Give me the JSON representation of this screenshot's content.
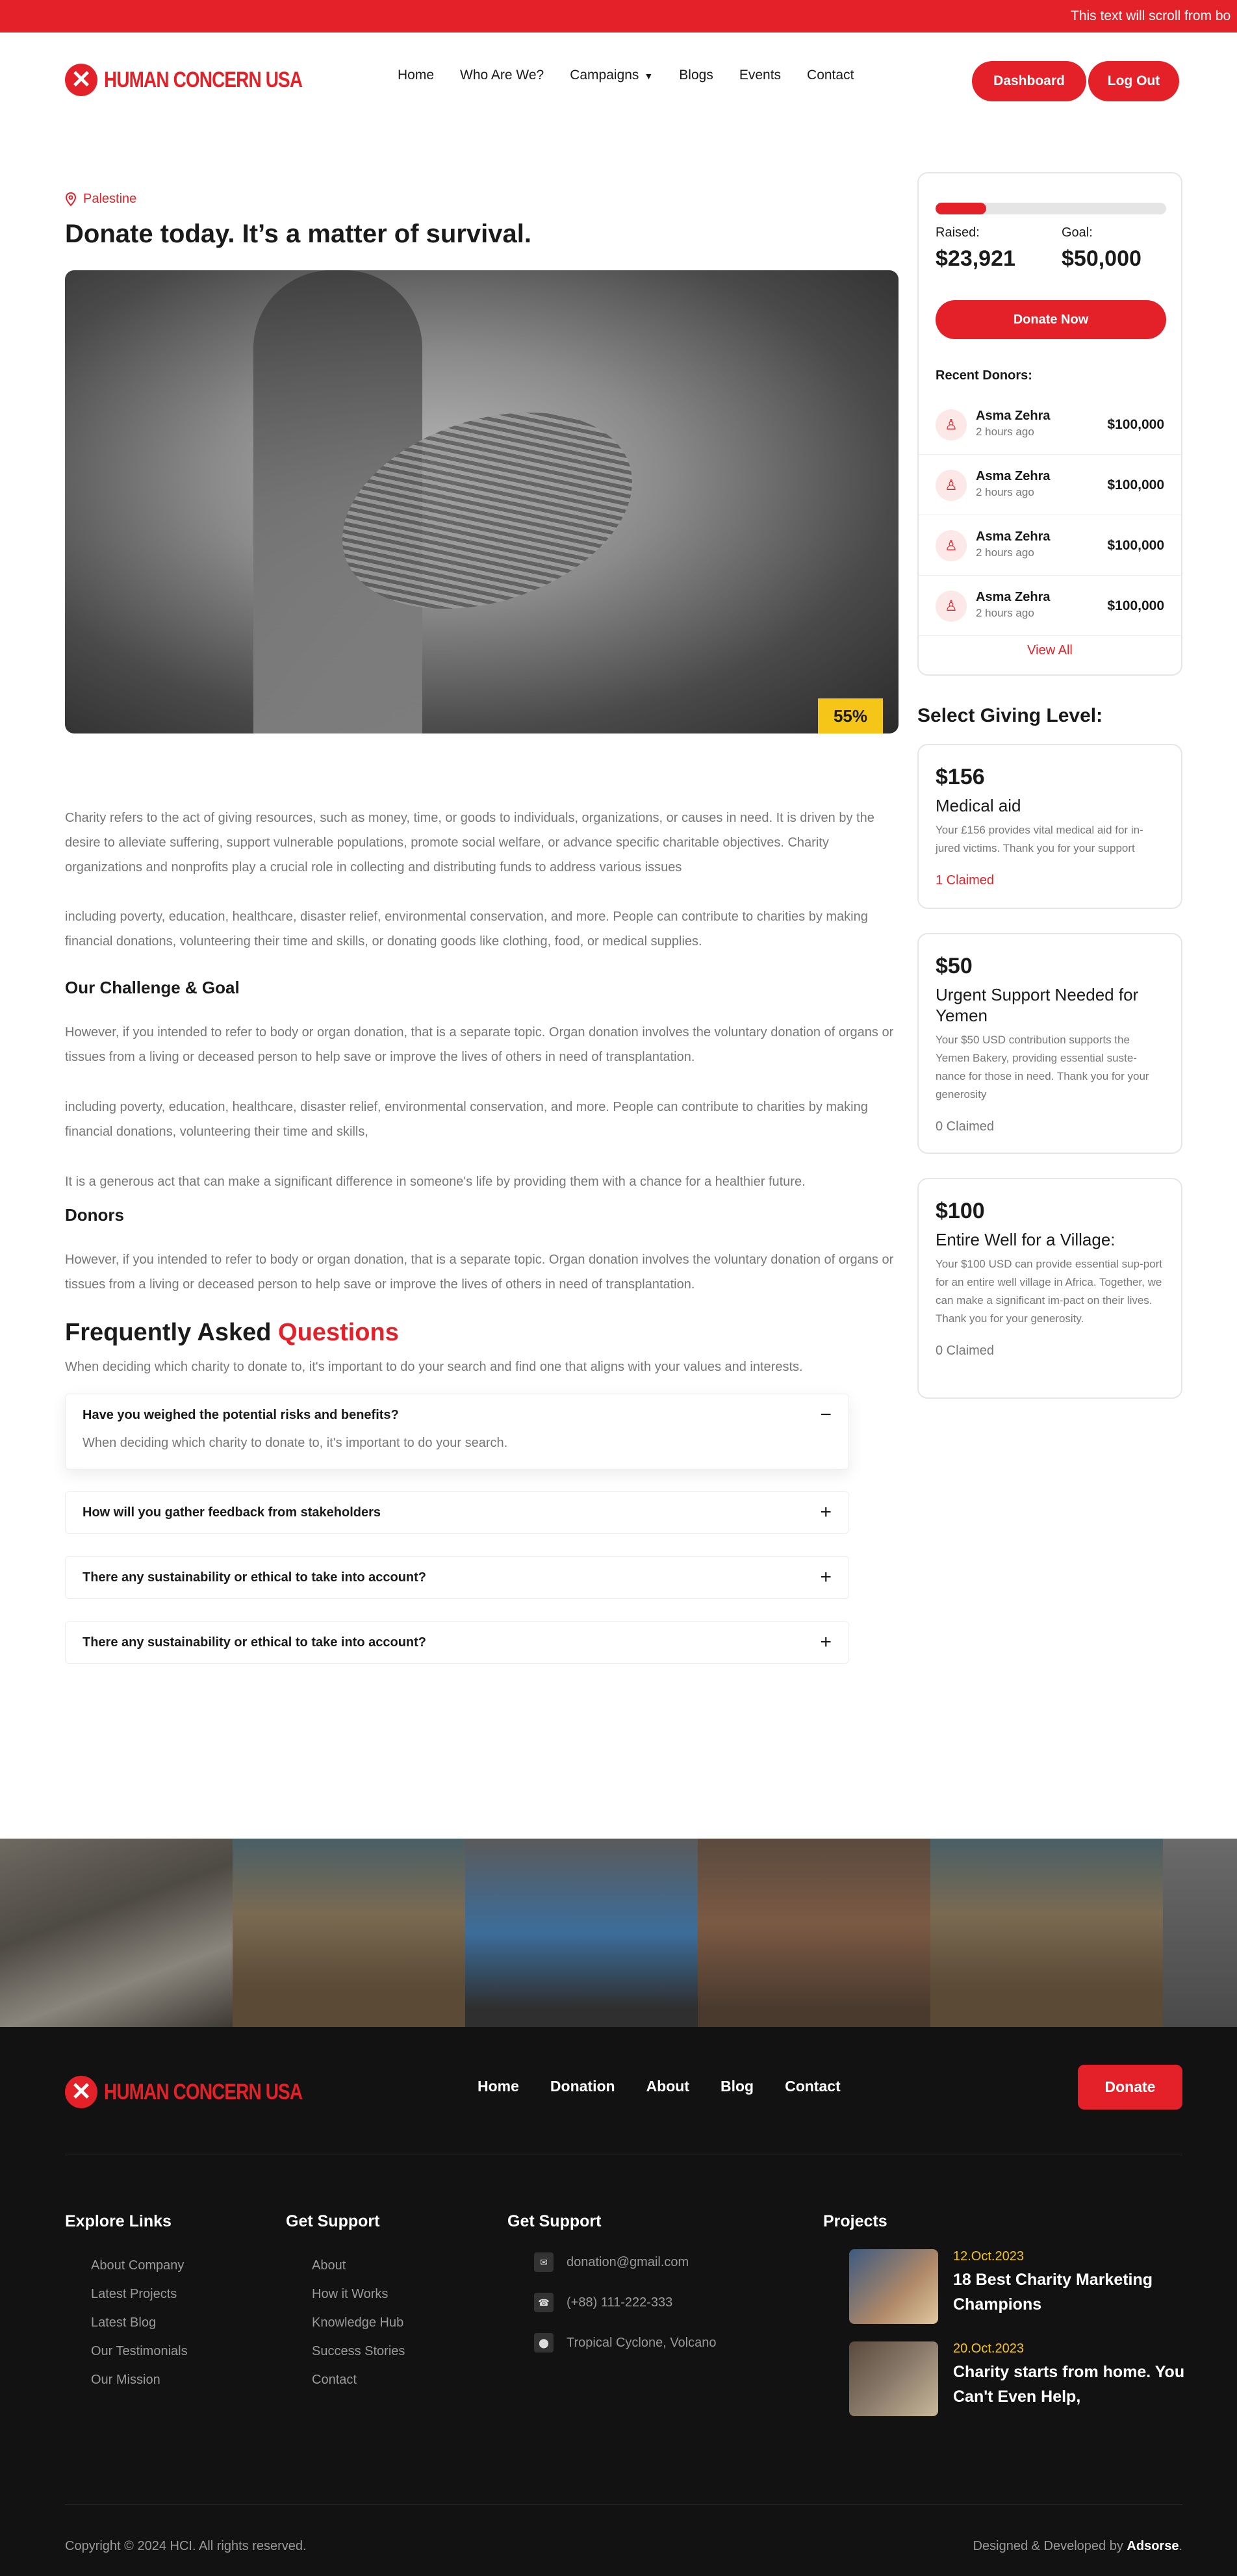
{
  "ticker": {
    "text": "This text will scroll from bo"
  },
  "header": {
    "logo_text": "HUMAN CONCERN USA",
    "nav": [
      "Home",
      "Who Are We?",
      "Campaigns",
      "Blogs",
      "Events",
      "Contact"
    ],
    "dashboard_label": "Dashboard",
    "logout_label": "Log Out"
  },
  "campaign": {
    "location": "Palestine",
    "title": "Donate today. It’s a matter of survival.",
    "progress_percent": "55%",
    "progress_fraction": 0.22,
    "paragraphs": [
      "Charity refers to the act of giving resources, such as money, time, or goods to individuals, organizations, or causes in need. It is driven by the desire to alleviate suffering, support vulnerable populations, promote social welfare, or advance specific charitable objectives. Charity organizations and nonprofits play a crucial role in collecting and distributing funds to address various issues",
      "including poverty, education, healthcare, disaster relief, environmental conservation, and more. People can contribute to charities by making financial donations, volunteering their time and skills, or donating goods like clothing, food, or medical supplies."
    ],
    "challenge_heading": "Our Challenge & Goal",
    "challenge_paragraphs": [
      "However, if you intended to refer to body or organ donation, that is a separate topic. Organ donation involves the voluntary donation of organs or tissues from a living or deceased person to help save or improve the lives of others in need of transplantation.",
      "including poverty, education, healthcare, disaster relief, environmental conservation, and more. People can contribute to charities by making financial donations, volunteering their time and skills,",
      "It is a generous act that can make a significant difference in someone's life by providing them with a chance for a healthier future."
    ],
    "donors_heading": "Donors",
    "donors_paragraph": "However, if you intended to refer to body or organ donation, that is a separate topic. Organ donation involves the voluntary donation of organs or tissues from a living or deceased person to help save or improve the lives of others in need of transplantation."
  },
  "faq": {
    "title_prefix": "Frequently Asked",
    "title_highlight": "Questions",
    "subtitle": "When deciding which charity to donate to, it's important to do your search and find one that aligns with your values and interests.",
    "items": [
      {
        "q": "Have you weighed the potential risks and benefits?",
        "a": "When deciding which charity to donate to, it's important to do your search.",
        "sign": "−"
      },
      {
        "q": "How will you gather feedback from stakeholders",
        "sign": "+"
      },
      {
        "q": "There any sustainability or ethical to take into account?",
        "sign": "+"
      },
      {
        "q": "There any sustainability or ethical to take into account?",
        "sign": "+"
      }
    ]
  },
  "donation_card": {
    "raised_label": "Raised:",
    "raised_value": "$23,921",
    "goal_label": "Goal:",
    "goal_value": "$50,000",
    "donate_label": "Donate Now",
    "recent_label": "Recent Donors:",
    "donors": [
      {
        "name": "Asma Zehra",
        "time": "2 hours ago",
        "amount": "$100,000"
      },
      {
        "name": "Asma Zehra",
        "time": "2 hours ago",
        "amount": "$100,000"
      },
      {
        "name": "Asma Zehra",
        "time": "2 hours ago",
        "amount": "$100,000"
      },
      {
        "name": "Asma Zehra",
        "time": "2 hours ago",
        "amount": "$100,000"
      }
    ],
    "view_all": "View All"
  },
  "giving": {
    "title": "Select Giving Level:",
    "levels": [
      {
        "price": "$156",
        "name": "Medical aid",
        "desc": "Your £156 provides vital medical aid for in-jured victims. Thank you for your support",
        "claimed": "1 Claimed"
      },
      {
        "price": "$50",
        "name": "Urgent Support Needed for Yemen",
        "desc": "Your $50 USD contribution supports the Yemen Bakery, providing essential suste-nance for those in need. Thank you for your generosity",
        "claimed": "0 Claimed"
      },
      {
        "price": "$100",
        "name": "Entire Well for a Village:",
        "desc": "Your $100 USD can provide essential sup-port for an entire well village in Africa. Together, we can make a significant im-pact on their lives. Thank you for your generosity.",
        "claimed": "0 Claimed"
      }
    ]
  },
  "footer": {
    "logo_text": "HUMAN CONCERN USA",
    "nav": [
      "Home",
      "Donation",
      "About",
      "Blog",
      "Contact"
    ],
    "donate_label": "Donate",
    "explore_title": "Explore Links",
    "explore_links": [
      "About Company",
      "Latest Projects",
      "Latest Blog",
      "Our Testimonials",
      "Our Mission"
    ],
    "support_title": "Get Support",
    "support_links": [
      "About",
      "How it Works",
      "Knowledge Hub",
      "Success Stories",
      "Contact"
    ],
    "contact_title": "Get Support",
    "contacts": [
      {
        "icon": "mail-icon",
        "text": "donation@gmail.com"
      },
      {
        "icon": "phone-icon",
        "text": "(+88) 111-222-333"
      },
      {
        "icon": "location-icon",
        "text": "Tropical Cyclone, Volcano"
      }
    ],
    "projects_title": "Projects",
    "projects": [
      {
        "date": "12.Oct.2023",
        "title": "18 Best Charity Marketing Champions"
      },
      {
        "date": "20.Oct.2023",
        "title": "Charity starts from home. You Can't Even Help,"
      }
    ],
    "copyright": "Copyright © 2024 HCI. All rights reserved.",
    "designed_prefix": "Designed & Developed by",
    "designed_brand": "Adsorse",
    "designed_suffix": "."
  },
  "colors": {
    "accent": "#e42128",
    "badge": "#f5c518",
    "footer_bg": "#121212"
  }
}
